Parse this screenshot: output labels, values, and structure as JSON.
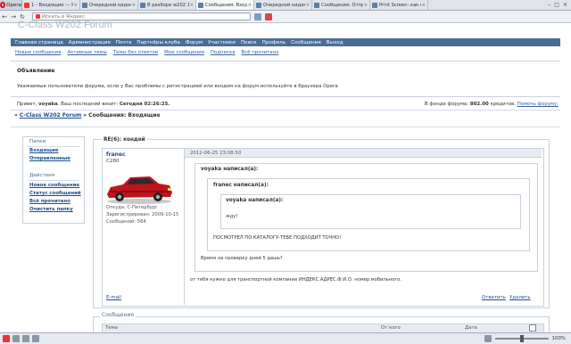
{
  "browser": {
    "menu_label": "Opera",
    "tabs": [
      {
        "label": "1 - Входящие — Янде..."
      },
      {
        "label": "Очередной кидок ????"
      },
      {
        "label": "В разборе w202 1.8л..."
      },
      {
        "label": "Сообщения: Входящие"
      },
      {
        "label": "Очередной кидок ????"
      },
      {
        "label": "Сообщения: Отправл..."
      },
      {
        "label": "Print Screen: как сдела..."
      }
    ],
    "search_placeholder": "Искать в Яндекс",
    "zoom": "100%"
  },
  "forum": {
    "title": "C-Class W202 Forum",
    "nav": [
      "Главная страница",
      "Администрация",
      "Почта",
      "Партнёры клуба",
      "Форум",
      "Участники",
      "Поиск",
      "Профиль",
      "Сообщения",
      "Выход"
    ],
    "subnav": [
      "Новые сообщения",
      "Активные темы",
      "Темы без ответов",
      "Мои сообщения",
      "Подписка",
      "Всё прочитано"
    ],
    "announcement_title": "Объявление",
    "announcement_text": "Уважаемые пользователи форума, если у Вас проблемы с регистрацией или входом на форум используйте в браузера Opera",
    "welcome_prefix": "Привет,",
    "welcome_user": "voyaka",
    "welcome_suffix": ". Ваш последний визит:",
    "last_visit": "Сегодня 02:26:25.",
    "fund_prefix": "В фонде форума:",
    "fund_amount": "802.00",
    "fund_suffix": "кредитов.",
    "fund_link": "Помочь форуму.",
    "breadcrumb_prefix": "»",
    "breadcrumb_link": "C-Class W202 Forum",
    "breadcrumb_rest": "» Сообщения: Входящие"
  },
  "sidebar": {
    "folders_title": "Папки",
    "folders": [
      "Входящие",
      "Отправленные"
    ],
    "actions_title": "Действия",
    "actions": [
      "Новое сообщение",
      "Статус сообщений",
      "Всё прочитано",
      "Очистить папку"
    ]
  },
  "message": {
    "subject": "RE(6): кондей",
    "author": "franec",
    "car": "C280",
    "from": "Откуда: С-Петербург",
    "registered": "Зарегистрирован: 2009-10-15",
    "posts": "Сообщений: 564",
    "date": "2012-06-25 23:08:50",
    "quote1_author": "voyaka написал(а):",
    "quote2_author": "franec написал(а):",
    "quote3_author": "voyaka написал(а):",
    "quote3_text": "жду!",
    "quote2_text": "ПОСМОТРЕЛ ПО КАТАЛОГУ-ТЕБЕ ПОДХОДИТ ТОЧНО!",
    "quote1_text": "Время на проверку дней 5 дашь?",
    "body": "от тебя нужно для транспортной компании ИНДЕКС.АДРЕС.Ф.И.О. номер мобильного.",
    "email_label": "E-mail",
    "reply_label": "Ответить",
    "delete_label": "Удалить"
  },
  "messages_table": {
    "title": "Сообщения",
    "col_subject": "Тема",
    "col_from": "От кого",
    "col_date": "Дата"
  },
  "colors": {
    "nav_bg": "#4a6d96",
    "link": "#1d4e8f",
    "car": "#c0141c"
  }
}
